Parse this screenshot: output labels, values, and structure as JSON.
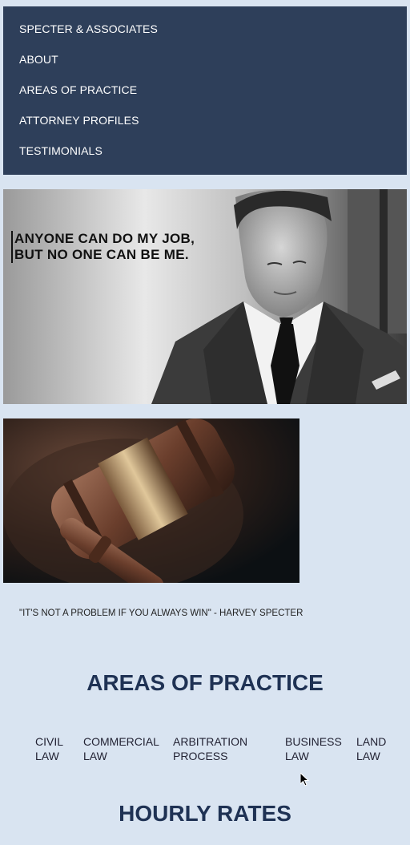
{
  "nav": {
    "items": [
      {
        "label": "SPECTER & ASSOCIATES"
      },
      {
        "label": "ABOUT"
      },
      {
        "label": "AREAS OF PRACTICE"
      },
      {
        "label": "ATTORNEY PROFILES"
      },
      {
        "label": "TESTIMONIALS"
      }
    ]
  },
  "hero": {
    "quote_line1": "ANYONE CAN DO MY JOB,",
    "quote_line2": "BUT NO ONE CAN BE ME."
  },
  "caption": "\"IT'S NOT A PROBLEM IF YOU ALWAYS WIN\" - HARVEY SPECTER",
  "practice": {
    "title": "AREAS OF PRACTICE",
    "areas": [
      {
        "line1": "CIVIL",
        "line2": "LAW"
      },
      {
        "line1": "COMMERCIAL",
        "line2": "LAW"
      },
      {
        "line1": "ARBITRATION",
        "line2": "PROCESS"
      },
      {
        "line1": "BUSINESS",
        "line2": "LAW"
      },
      {
        "line1": "LAND",
        "line2": "LAW"
      }
    ]
  },
  "rates": {
    "title": "HOURLY RATES"
  },
  "colors": {
    "page_bg": "#d9e4f1",
    "nav_bg": "#2e3f5a",
    "heading": "#1f3254"
  }
}
